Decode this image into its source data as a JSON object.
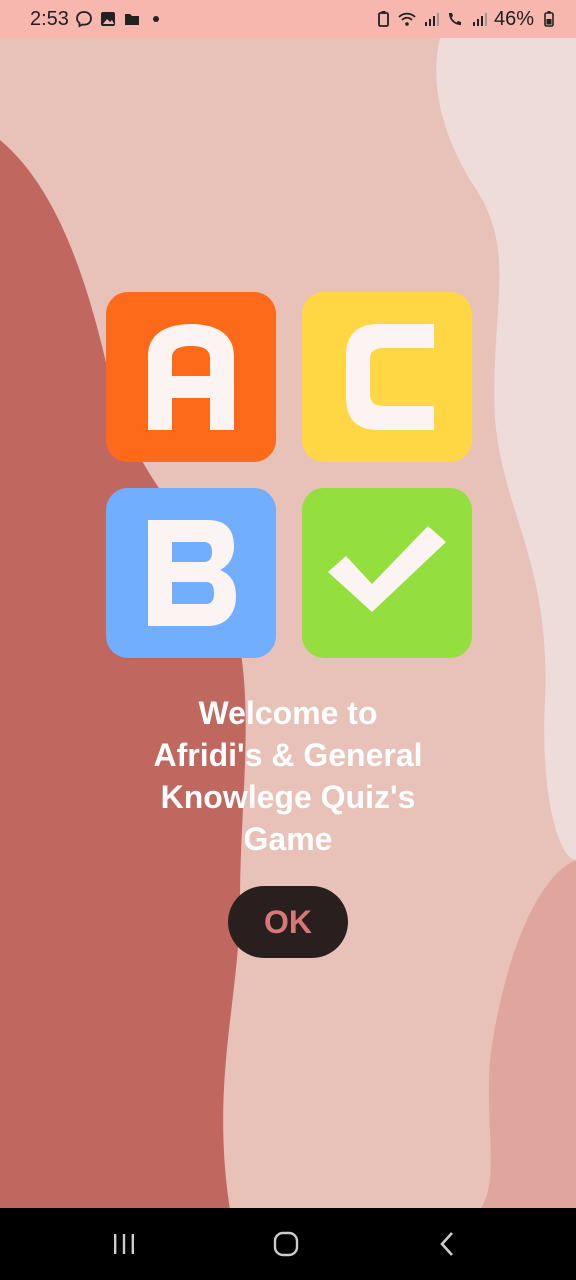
{
  "status_bar": {
    "time": "2:53",
    "battery": "46%",
    "icons": [
      "messenger-notification-icon",
      "gallery-notification-icon",
      "folder-notification-icon",
      "more-dot-icon",
      "battery-saver-icon",
      "wifi-icon",
      "signal-icon",
      "wifi-calling-icon",
      "signal-icon-2",
      "battery-icon"
    ]
  },
  "logo": {
    "tiles": [
      {
        "letter": "A",
        "color": "#fd6a1a"
      },
      {
        "letter": "C",
        "color": "#ffd745"
      },
      {
        "letter": "B",
        "color": "#71aefe"
      },
      {
        "icon": "checkmark-icon",
        "color": "#94df3e"
      }
    ]
  },
  "welcome": {
    "lines": [
      "Welcome to",
      "Afridi's & General",
      "Knowlege Quiz's",
      "Game"
    ]
  },
  "ok_button": {
    "label": "OK"
  },
  "nav_bar": {
    "buttons": [
      "recent-apps-icon",
      "home-icon",
      "back-icon"
    ]
  },
  "colors": {
    "background": "#e8c1b8",
    "dark_shape": "#c0675f",
    "light_shape": "#eddcda",
    "button_bg": "#2a1f1f",
    "button_text": "#d67a78"
  }
}
